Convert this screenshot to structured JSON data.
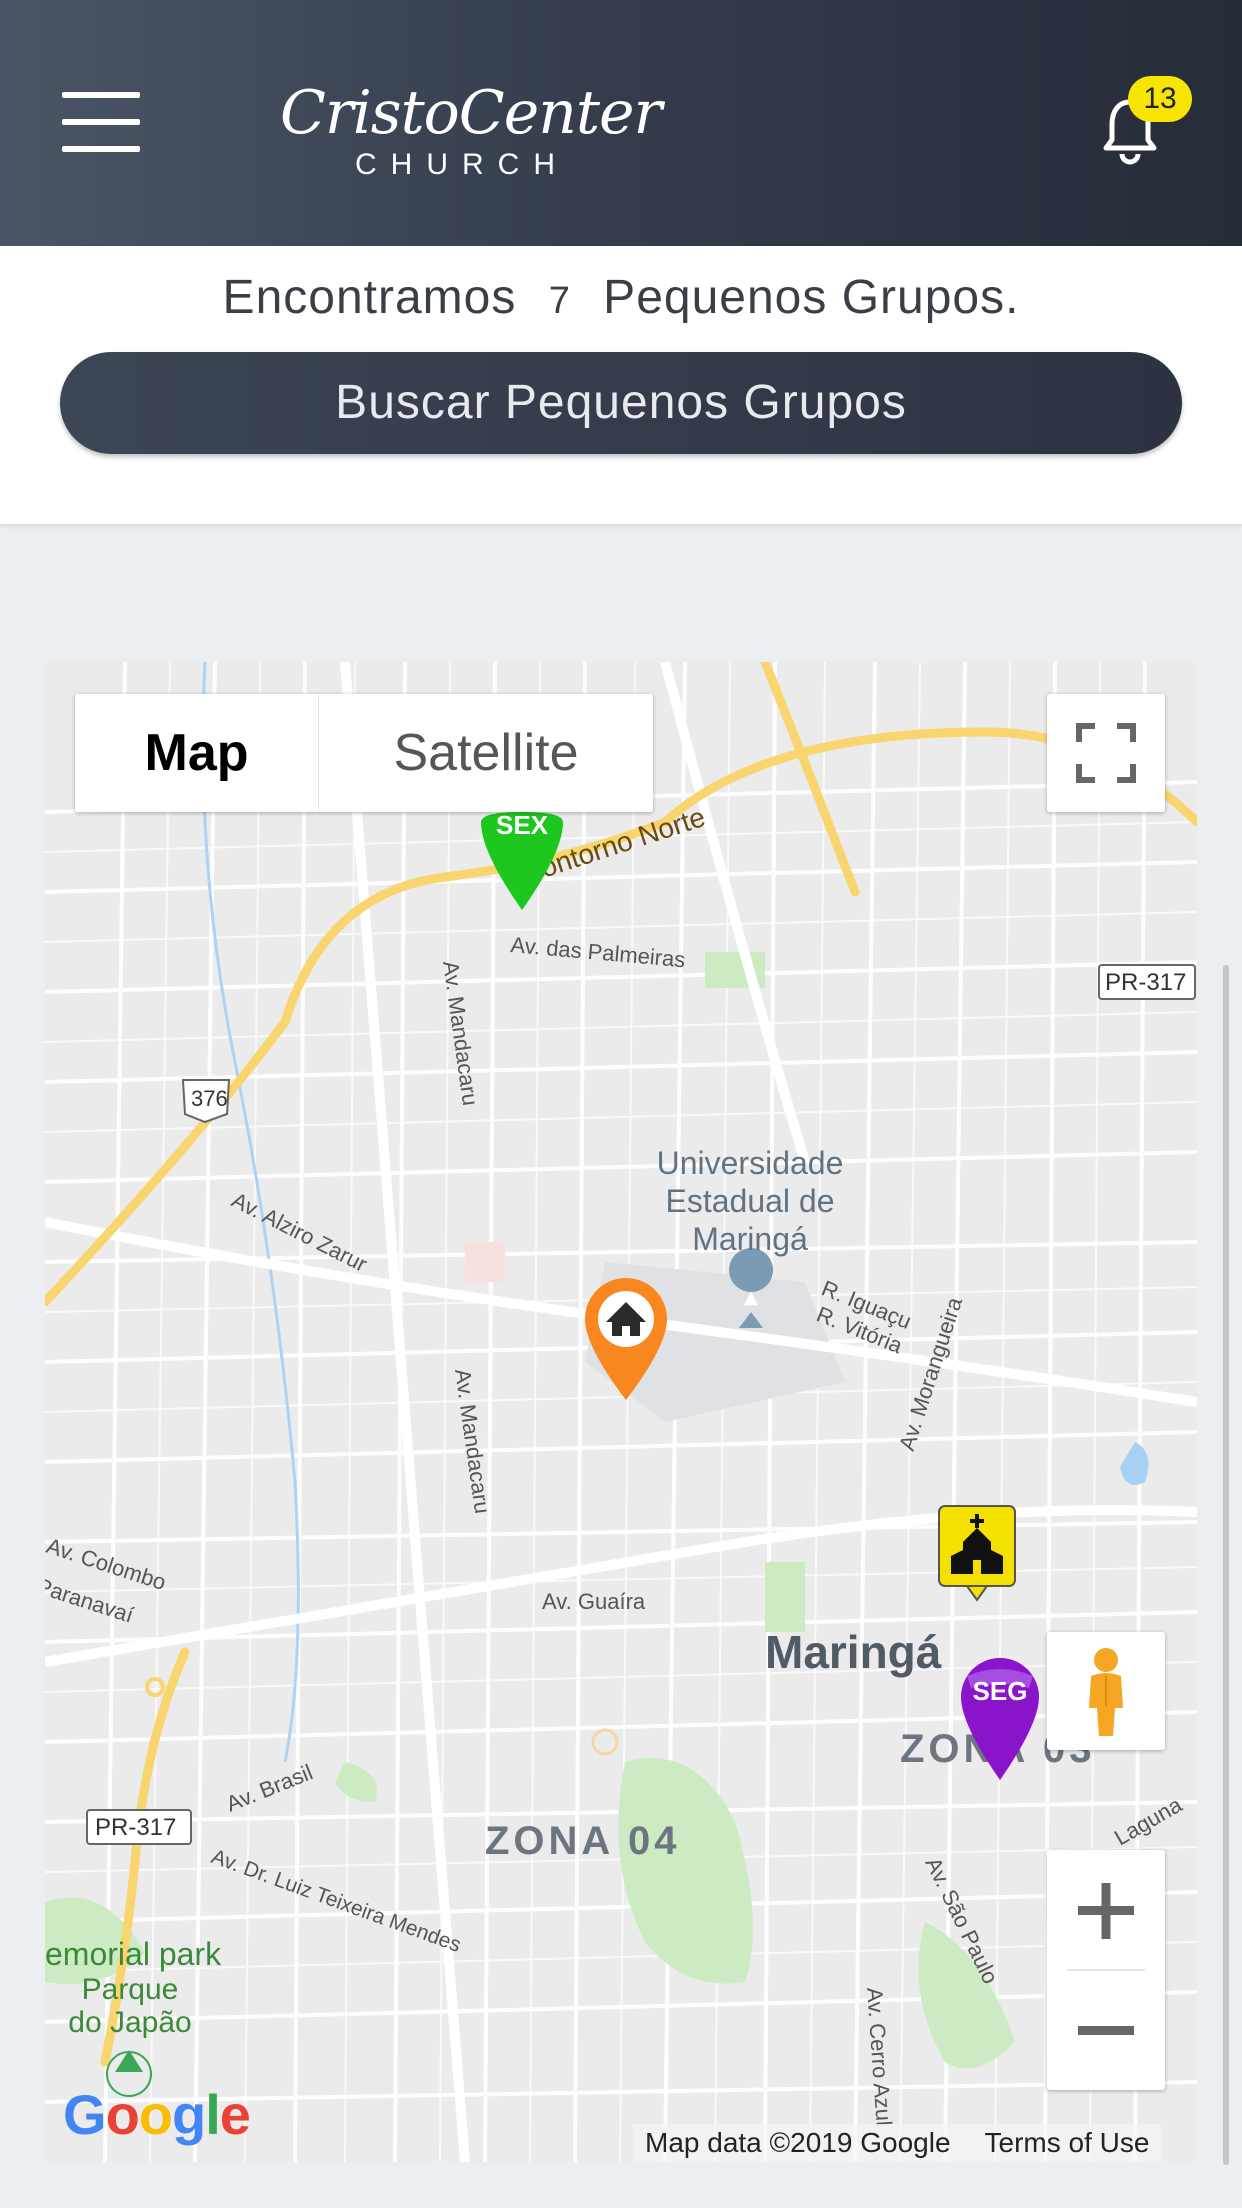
{
  "header": {
    "logo_script": "CristoCenter",
    "logo_sub": "CHURCH",
    "notification_count": "13"
  },
  "results": {
    "prefix": "Encontramos",
    "count": "7",
    "suffix": "Pequenos Grupos.",
    "search_button": "Buscar Pequenos Grupos"
  },
  "map": {
    "type_map": "Map",
    "type_satellite": "Satellite",
    "attribution_data": "Map data ©2019 Google",
    "attribution_terms": "Terms of Use",
    "google_logo": "Google",
    "labels": {
      "contorno": "Contorno Norte",
      "palmeiras": "Av. das Palmeiras",
      "pr317_top": "PR-317",
      "r376": "376",
      "mandacaru1": "Av. Mandacaru",
      "mandacaru2": "Av. Mandacaru",
      "uem1": "Universidade",
      "uem2": "Estadual de",
      "uem3": "Maringá",
      "alziro": "Av. Alziro Zarur",
      "iguacu": "R. Iguaçu",
      "vitoria": "R. Vitória",
      "morangueira": "Av. Morangueira",
      "colombo": "Av. Colombo",
      "paranavai": "Paranavaí",
      "guaira": "Av. Guaíra",
      "maringa": "Maringá",
      "zona03": "ZONA 03",
      "zona04": "ZONA 04",
      "brasil": "Av. Brasil",
      "pr317_bottom": "PR-317",
      "luiz": "Av. Dr. Luiz Teixeira Mendes",
      "memorial": "emorial park",
      "parque1": "Parque",
      "parque2": "do Japão",
      "saopaulo": "Av. São Paulo",
      "cerro": "Av. Cerro Azul",
      "laguna": "Laguna"
    },
    "markers": {
      "sex": "SEX",
      "seg": "SEG"
    },
    "colors": {
      "marker_sex": "#1ec71e",
      "marker_seg": "#8a14c9",
      "marker_home": "#f7871e",
      "marker_church": "#f5e100"
    }
  }
}
